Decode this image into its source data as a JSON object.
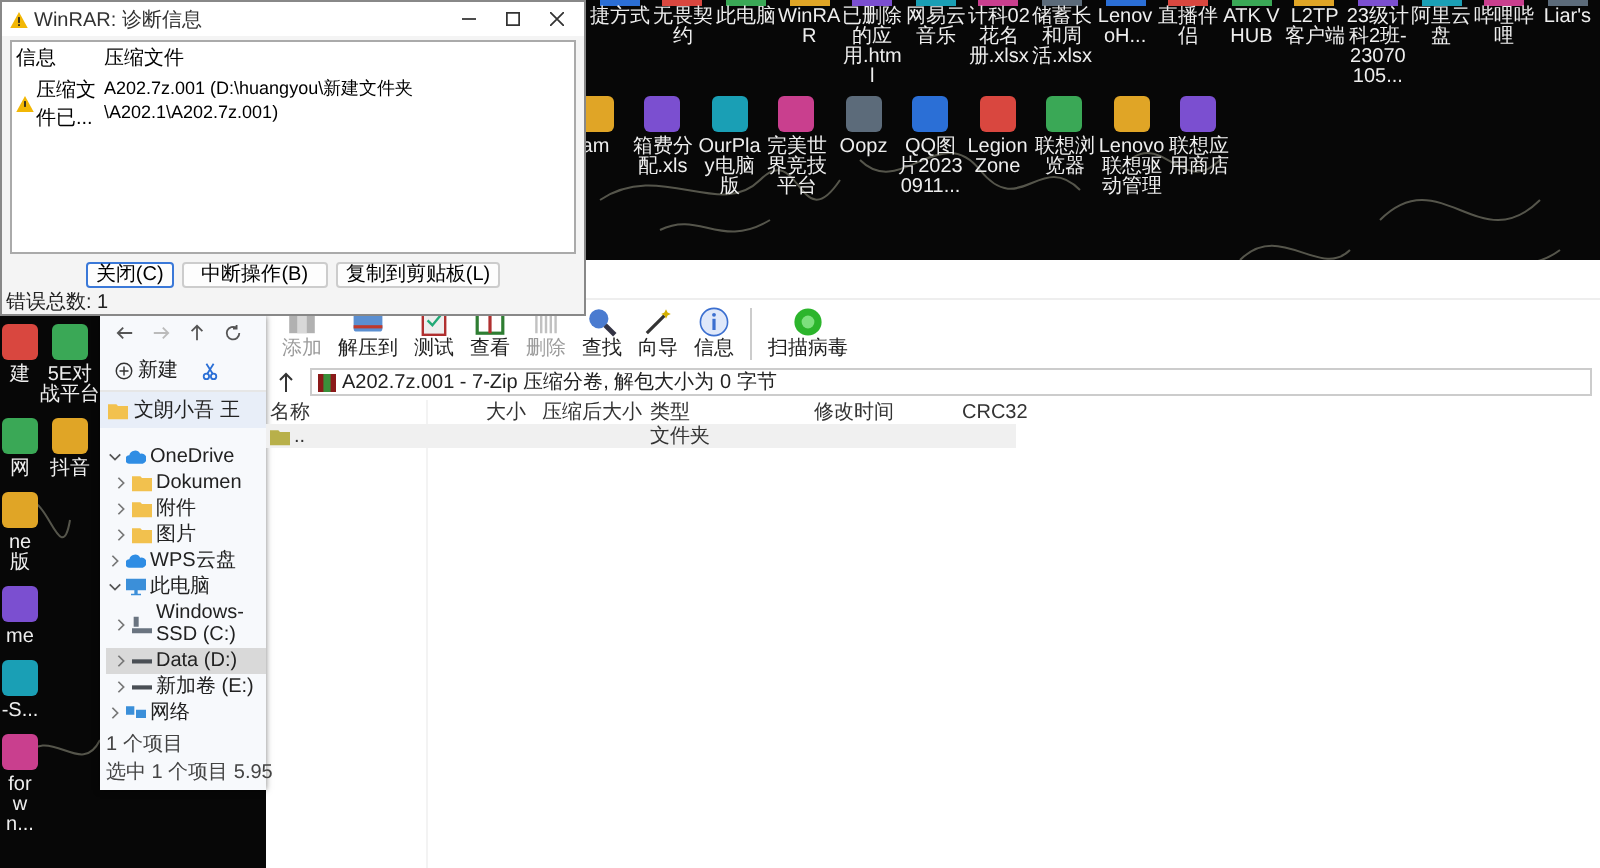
{
  "desktop": {
    "top_row": [
      "捷方式",
      "无畏契约",
      "此电脑",
      "WinRAR",
      "已删除的应用.html",
      "网易云音乐",
      "计科02花名册.xlsx",
      "储蓄长和周活.xlsx",
      "LenovoH...",
      "直播伴侣",
      "ATK V HUB",
      "L2TP客户端",
      "23级计科2班-23070105...",
      "阿里云盘",
      "哔哩哔哩",
      "Liar's"
    ],
    "second_row": [
      "am",
      "箱费分配.xls",
      "OurPlay电脑版",
      "完美世界竞技平台",
      "Oopz",
      "QQ图片20230911...",
      "Legion Zone",
      "联想浏览器",
      "Lenovo联想驱动管理",
      "联想应用商店"
    ],
    "left_column": [
      [
        "建",
        "5E对战平台"
      ],
      [
        "网",
        "抖音"
      ],
      [
        "ne版"
      ],
      [
        "me"
      ],
      [
        "-S..."
      ],
      [
        "for wn..."
      ]
    ]
  },
  "diagnostic_dialog": {
    "title": "WinRAR: 诊断信息",
    "columns": [
      "信息",
      "压缩文件"
    ],
    "rows": [
      {
        "message": "压缩文件已...",
        "archive": "A202.7z.001 (D:\\huangyou\\新建文件夹\\A202.1\\A202.7z.001)"
      }
    ],
    "buttons": [
      {
        "label": "关闭(C)",
        "focused": true
      },
      {
        "label": "中断操作(B)",
        "focused": false
      },
      {
        "label": "复制到剪贴板(L)",
        "focused": false
      }
    ],
    "status": "错误总数: 1"
  },
  "winrar": {
    "toolbar": [
      {
        "kind": "add",
        "label": "添加",
        "disabled": true
      },
      {
        "kind": "extract",
        "label": "解压到",
        "disabled": false
      },
      {
        "kind": "test",
        "label": "测试",
        "disabled": false
      },
      {
        "kind": "view",
        "label": "查看",
        "disabled": false
      },
      {
        "kind": "delete",
        "label": "删除",
        "disabled": true
      },
      {
        "kind": "find",
        "label": "查找",
        "disabled": false
      },
      {
        "kind": "wizard",
        "label": "向导",
        "disabled": false
      },
      {
        "kind": "info",
        "label": "信息",
        "disabled": false
      },
      {
        "kind": "scan",
        "label": "扫描病毒",
        "disabled": false
      }
    ],
    "address": "A202.7z.001 - 7-Zip 压缩分卷, 解包大小为 0 字节",
    "columns": [
      "名称",
      "大小",
      "压缩后大小",
      "类型",
      "修改时间",
      "CRC32"
    ],
    "rows": [
      {
        "name": "..",
        "type": "文件夹"
      }
    ]
  },
  "explorer": {
    "new_label": "新建",
    "quick_access": "文朗小吾 王",
    "tree": [
      {
        "kind": "cloud",
        "label": "OneDrive",
        "expanded": true,
        "selected": false,
        "children": [
          {
            "kind": "folder",
            "label": "Dokumen",
            "expanded": false,
            "selected": false
          },
          {
            "kind": "folder",
            "label": "附件",
            "expanded": false,
            "selected": false
          },
          {
            "kind": "folder",
            "label": "图片",
            "expanded": false,
            "selected": false
          }
        ]
      },
      {
        "kind": "cloud",
        "label": "WPS云盘",
        "expanded": false,
        "selected": false
      },
      {
        "kind": "pc",
        "label": "此电脑",
        "expanded": true,
        "selected": false,
        "children": [
          {
            "kind": "system-drive",
            "label": "Windows-SSD (C:)",
            "expanded": false,
            "selected": false
          },
          {
            "kind": "drive",
            "label": "Data (D:)",
            "expanded": false,
            "selected": true
          },
          {
            "kind": "drive",
            "label": "新加卷 (E:)",
            "expanded": false,
            "selected": false
          }
        ]
      },
      {
        "kind": "network",
        "label": "网络",
        "expanded": false,
        "selected": false
      }
    ],
    "status": [
      "1 个项目",
      "选中 1 个项目 5.95"
    ]
  }
}
